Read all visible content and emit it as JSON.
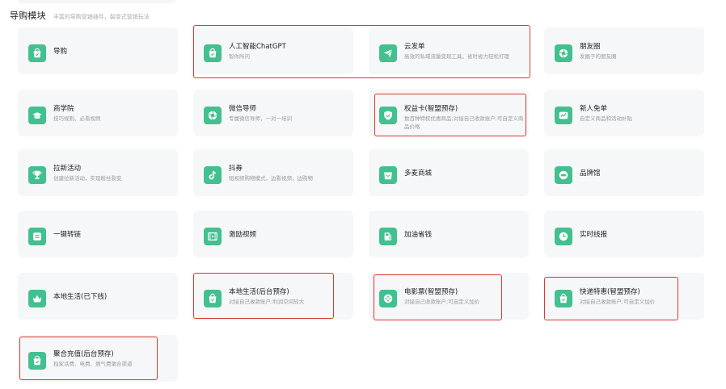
{
  "header": {
    "title": "导购模块",
    "subtitle": "丰富的导购营销插件，裂变式营销玩法"
  },
  "colors": {
    "accent": "#43c08f",
    "highlight": "#d93a2e",
    "card_bg": "#f6f7f8"
  },
  "modules": [
    {
      "name": "导购",
      "desc": "",
      "icon": "shopping-bag-icon"
    },
    {
      "name": "人工智能ChatGPT",
      "desc": "智你所问",
      "icon": "shopping-bag-icon"
    },
    {
      "name": "云发单",
      "desc": "高效的私域流量变现工具，省时省力轻松打理",
      "icon": "paper-plane-icon"
    },
    {
      "name": "朋友圈",
      "desc": "发圈子的朋友圈",
      "icon": "aperture-icon"
    },
    {
      "name": "商学院",
      "desc": "技巧规则、必看视频",
      "icon": "graduation-cap-icon"
    },
    {
      "name": "微信导师",
      "desc": "专属微信导师，一对一培训",
      "icon": "aperture-icon"
    },
    {
      "name": "权益卡(智盟预存)",
      "desc": "数百种特权优惠商品;对接自己收款账户;可自定义商品价格",
      "icon": "shield-check-icon"
    },
    {
      "name": "新人免单",
      "desc": "自定义商品和活动补贴",
      "icon": "gift-card-icon"
    },
    {
      "name": "拉新活动",
      "desc": "创建拉新活动，实现粉丝裂变",
      "icon": "trophy-icon"
    },
    {
      "name": "抖券",
      "desc": "短视频购物模式，边看视频，边购物",
      "icon": "tiktok-note-icon"
    },
    {
      "name": "多麦商城",
      "desc": "",
      "icon": "shop-icon"
    },
    {
      "name": "品牌馆",
      "desc": "",
      "icon": "brand-badge-icon"
    },
    {
      "name": "一键转链",
      "desc": "",
      "icon": "link-card-icon"
    },
    {
      "name": "激励视频",
      "desc": "",
      "icon": "film-icon"
    },
    {
      "name": "加油省钱",
      "desc": "",
      "icon": "fuel-pump-icon"
    },
    {
      "name": "实时线报",
      "desc": "",
      "icon": "clock-icon"
    },
    {
      "name": "本地生活(已下线)",
      "desc": "",
      "icon": "crown-icon"
    },
    {
      "name": "本地生活(后台预存)",
      "desc": "对接自己收款账户;利润空间较大",
      "icon": "shopping-bag-icon"
    },
    {
      "name": "电影票(智盟预存)",
      "desc": "对接自己收款账户;可自定义加价",
      "icon": "film-reel-icon"
    },
    {
      "name": "快递特惠(智盟预存)",
      "desc": "对接自己收款账户;可自定义加价",
      "icon": "shopping-bag-icon"
    },
    {
      "name": "聚合充值(后台预存)",
      "desc": "独家话费、电费、燃气费聚合渠道",
      "icon": "shopping-bag-icon"
    }
  ]
}
